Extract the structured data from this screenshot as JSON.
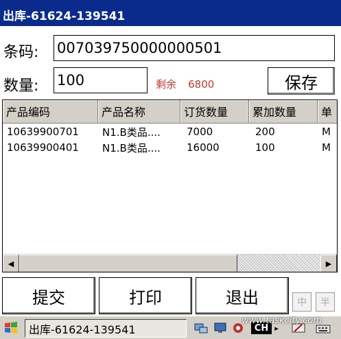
{
  "window": {
    "title": "出库-61624-139541"
  },
  "form": {
    "barcode_label": "条码:",
    "barcode_value": "007039750000000501",
    "qty_label": "数量:",
    "qty_value": "100",
    "remain_label": "剩余",
    "remain_value": "6800",
    "save_label": "保存"
  },
  "grid": {
    "columns": [
      "产品编码",
      "产品名称",
      "订货数量",
      "累加数量",
      "单"
    ],
    "rows": [
      [
        "10639900701",
        "N1.B类品....",
        "7000",
        "200",
        "M"
      ],
      [
        "10639900401",
        "N1.B类品....",
        "16000",
        "100",
        "M"
      ]
    ]
  },
  "buttons": {
    "submit": "提交",
    "print": "打印",
    "exit": "退出",
    "ime_cn": "中",
    "ime_half": "半"
  },
  "taskbar": {
    "task_label": "出库-61624-139541",
    "lang": "CH",
    "watermark": "www.taskcity.com"
  },
  "colors": {
    "titlebar": "#0a2b8c",
    "remain_text": "#c0392b"
  }
}
